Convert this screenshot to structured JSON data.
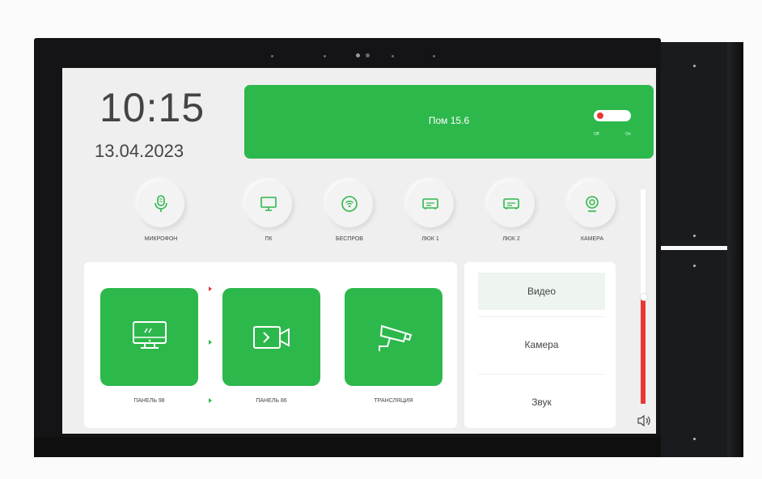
{
  "header": {
    "time": "10:15",
    "date": "13.04.2023"
  },
  "banner": {
    "title": "Пом 15.6",
    "toggle_off": "Off",
    "toggle_on": "On"
  },
  "quick_buttons": [
    {
      "label": "МИКРОФОН",
      "icon": "microphone-icon"
    },
    {
      "label": "ПК",
      "icon": "monitor-icon"
    },
    {
      "label": "БЕСПРОВ",
      "icon": "wifi-icon"
    },
    {
      "label": "ЛЮК 1",
      "icon": "projector-icon"
    },
    {
      "label": "ЛЮК 2",
      "icon": "projector-icon"
    },
    {
      "label": "КАМЕРА",
      "icon": "webcam-icon"
    }
  ],
  "sources": [
    {
      "label": "ПАНЕЛЬ 98",
      "icon": "pc-monitor-icon"
    },
    {
      "label": "ПАНЕЛЬ 86",
      "icon": "video-icon"
    },
    {
      "label": "ТРАНСЛЯЦИЯ",
      "icon": "cctv-camera-icon"
    }
  ],
  "menu": {
    "items": [
      "Видео",
      "Камера",
      "Звук"
    ],
    "selected": "Видео"
  },
  "volume": {
    "level_percent": 49
  },
  "colors": {
    "accent": "#2db84c",
    "alert": "#e53935",
    "device": "#141416"
  }
}
